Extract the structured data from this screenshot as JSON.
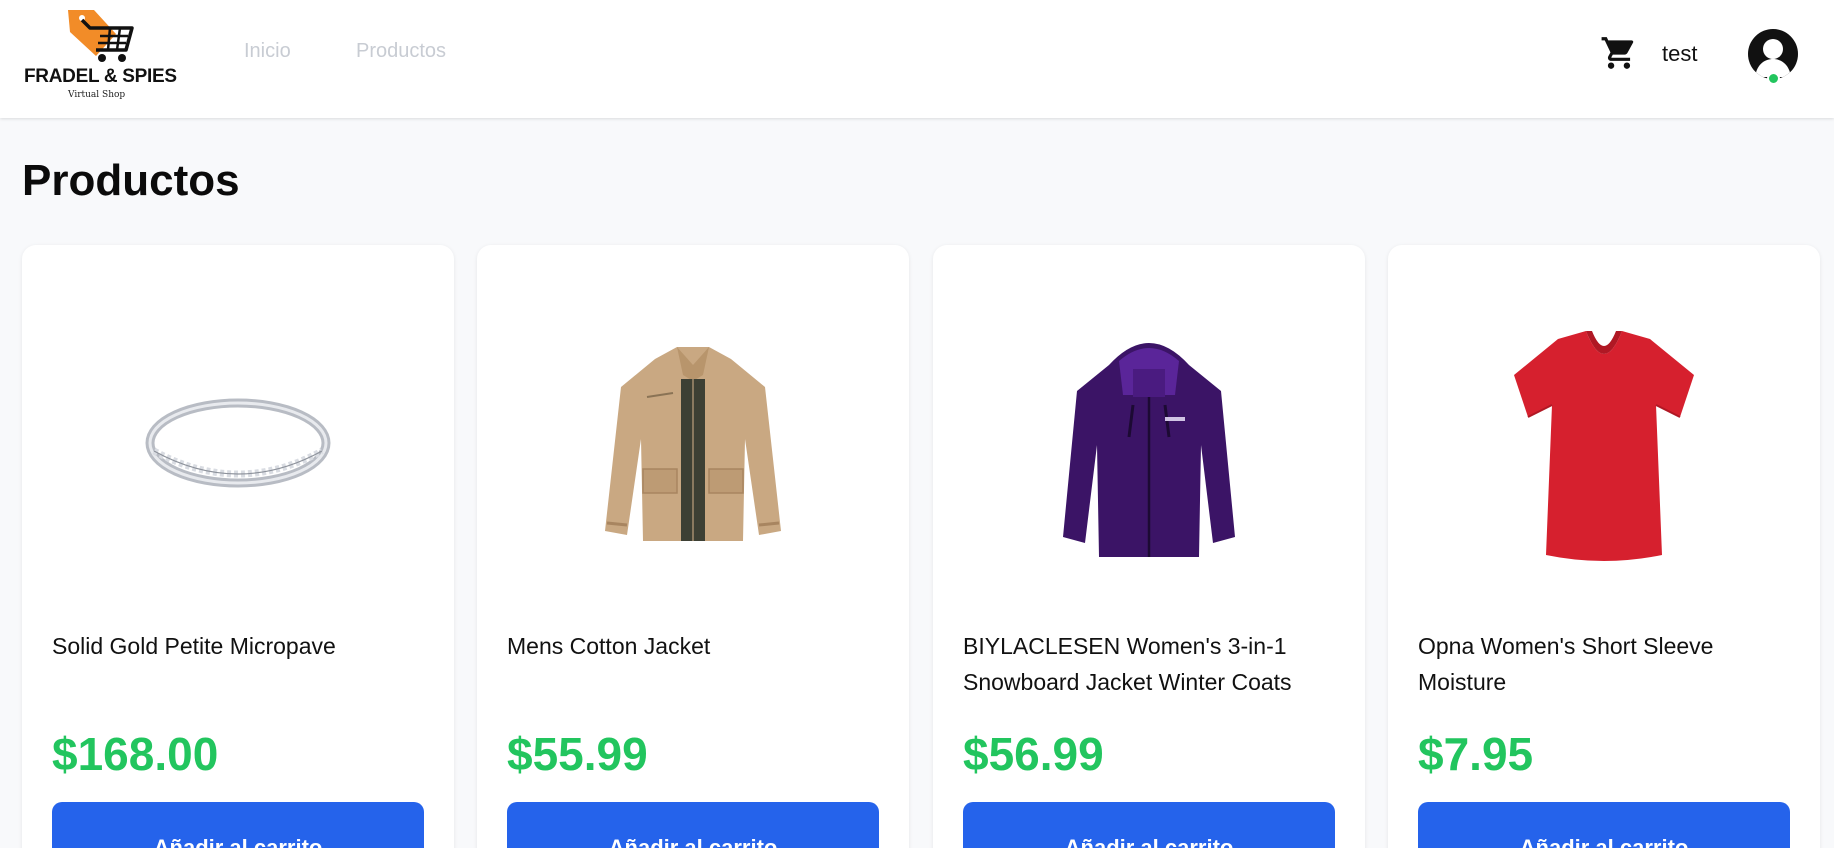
{
  "brand": {
    "name": "FRADEL & SPIES",
    "tagline": "Virtual Shop",
    "accent": "#f28c28"
  },
  "nav": {
    "items": [
      {
        "label": "Inicio"
      },
      {
        "label": "Productos"
      }
    ]
  },
  "header": {
    "cart_icon": "cart-icon",
    "username": "test",
    "avatar_icon": "user-avatar-icon",
    "status": "online"
  },
  "page": {
    "title": "Productos"
  },
  "products": [
    {
      "name": "Solid Gold Petite Micropave",
      "price": "$168.00",
      "button": "Añadir al carrito",
      "image": "ring-image"
    },
    {
      "name": "Mens Cotton Jacket",
      "price": "$55.99",
      "button": "Añadir al carrito",
      "image": "jacket-image"
    },
    {
      "name": "BIYLACLESEN Women's 3-in-1 Snowboard Jacket Winter Coats",
      "price": "$56.99",
      "button": "Añadir al carrito",
      "image": "snowboard-jacket-image"
    },
    {
      "name": "Opna Women's Short Sleeve Moisture",
      "price": "$7.95",
      "button": "Añadir al carrito",
      "image": "tshirt-image"
    }
  ],
  "colors": {
    "price": "#22c55e",
    "button": "#2563eb",
    "nav_inactive": "#c8ccd3",
    "background": "#f8f9fb"
  }
}
